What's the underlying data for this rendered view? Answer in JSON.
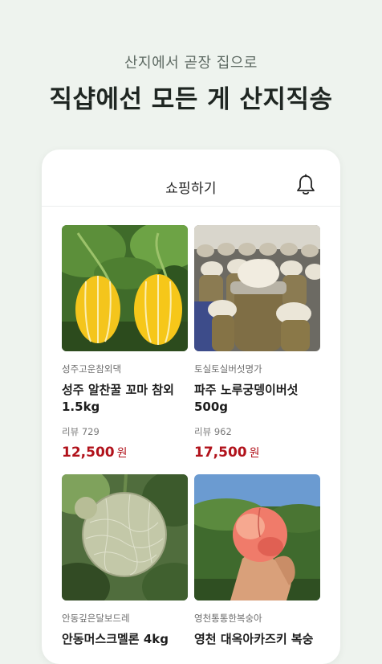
{
  "promo": {
    "subtitle": "산지에서 곧장 집으로",
    "title": "직샵에선 모든 게 산지직송"
  },
  "app": {
    "title": "쇼핑하기",
    "bell_icon": "bell-icon"
  },
  "products": [
    {
      "seller": "성주고운참외댁",
      "name": "성주 알찬꿀 꼬마 참외 1.5kg",
      "review_label": "리뷰 729",
      "price": "12,500",
      "currency": "원",
      "image": "oriental-melon-photo"
    },
    {
      "seller": "토실토실버섯명가",
      "name": "파주 노루궁뎅이버섯 500g",
      "review_label": "리뷰 962",
      "price": "17,500",
      "currency": "원",
      "image": "mushroom-bottles-photo"
    },
    {
      "seller": "안동깊은달보드레",
      "name": "안동머스크멜론 4kg",
      "image": "muskmelon-photo"
    },
    {
      "seller": "영천통통한복숭아",
      "name": "영천 대옥아카즈키 복숭",
      "image": "peach-in-hand-photo"
    }
  ],
  "colors": {
    "background": "#eef3ee",
    "price": "#b1121b"
  }
}
